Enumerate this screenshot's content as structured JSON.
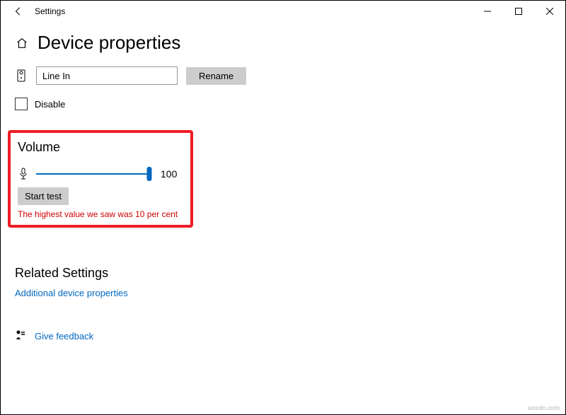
{
  "window": {
    "app_name": "Settings"
  },
  "page": {
    "title": "Device properties"
  },
  "device": {
    "name_value": "Line In",
    "rename_label": "Rename",
    "disable_label": "Disable"
  },
  "volume": {
    "section_title": "Volume",
    "value": "100",
    "start_test_label": "Start test",
    "test_result": "The highest value we saw was 10 per cent"
  },
  "related": {
    "section_title": "Related Settings",
    "additional_link": "Additional device properties"
  },
  "feedback": {
    "link_label": "Give feedback"
  },
  "watermark": "wsxdn.com"
}
